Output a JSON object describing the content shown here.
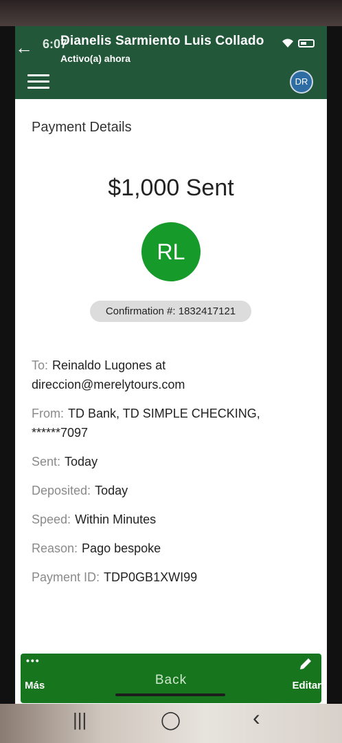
{
  "header": {
    "status_time": "6:07",
    "contact_name": "Dianelis Sarmiento Luis Collado",
    "contact_status": "Activo(a) ahora",
    "user_initials": "DR"
  },
  "payment": {
    "title": "Payment Details",
    "amount_text": "$1,000 Sent",
    "recipient_initials": "RL",
    "confirmation": "Confirmation #: 1832417121",
    "details": [
      {
        "label": "To:",
        "value": "Reinaldo Lugones at direccion@merelytours.com"
      },
      {
        "label": "From:",
        "value": "TD Bank, TD SIMPLE CHECKING, ******7097"
      },
      {
        "label": "Sent:",
        "value": "Today"
      },
      {
        "label": "Deposited:",
        "value": "Today"
      },
      {
        "label": "Speed:",
        "value": "Within Minutes"
      },
      {
        "label": "Reason:",
        "value": "Pago bespoke"
      },
      {
        "label": "Payment ID:",
        "value": "TDP0GB1XWI99"
      }
    ]
  },
  "actions": {
    "more_dots": "•••",
    "more_label": "Más",
    "back_label": "Back",
    "edit_label": "Editar"
  },
  "nav": {
    "recents": "|||",
    "home": "◯",
    "back": "‹"
  },
  "colors": {
    "header_bg": "#22573a",
    "action_bar_bg": "#17761d",
    "recipient_avatar": "#169a2a",
    "user_avatar": "#2e6da4"
  }
}
